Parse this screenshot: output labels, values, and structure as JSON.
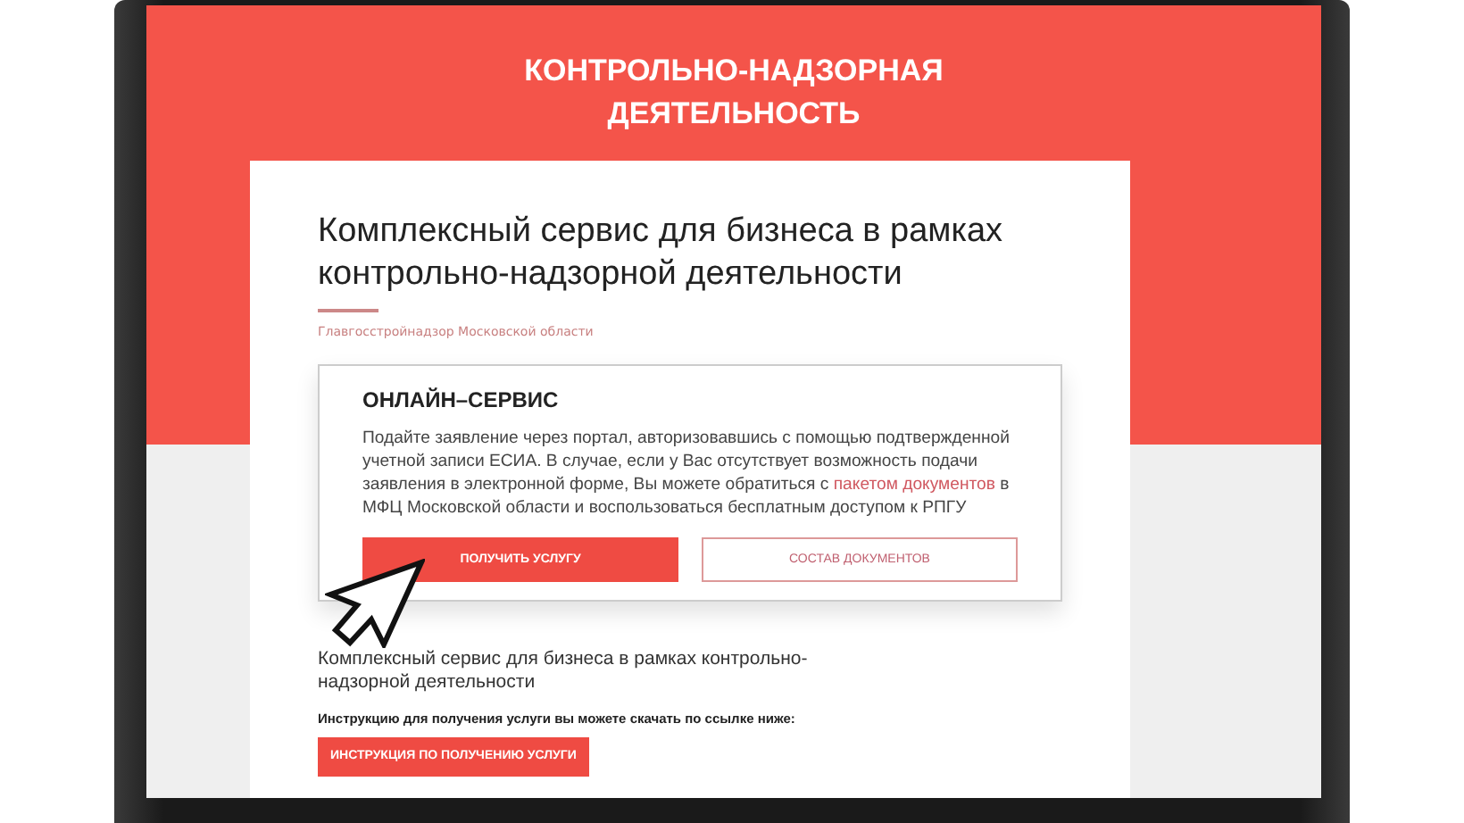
{
  "header": {
    "title": "КОНТРОЛЬНО-НАДЗОРНАЯ ДЕЯТЕЛЬНОСТЬ"
  },
  "card": {
    "heading": "Комплексный сервис для бизнеса в рамках контрольно-надзорной деятельности",
    "subtitle": "Главгосстройнадзор Московской области",
    "online_service": {
      "title": "ОНЛАЙН–СЕРВИС",
      "text_before": "Подайте заявление через портал, авторизовавшись с помощью подтвержденной учетной записи ЕСИА. В случае, если у Вас отсутствует возможность подачи заявления в электронной форме, Вы можете обратиться с ",
      "link": "пакетом документов",
      "text_after": " в МФЦ Московской области и воспользоваться бесплатным доступом к РПГУ",
      "buttons": [
        {
          "label": "ПОЛУЧИТЬ УСЛУГУ",
          "kind": "primary"
        },
        {
          "label": "СОСТАВ ДОКУМЕНТОВ",
          "kind": "outline"
        }
      ]
    },
    "description": "Комплексный сервис для бизнеса в рамках контрольно-надзорной деятельности",
    "instruction_note": "Инструкцию для получения услуги вы можете скачать по ссылке ниже:",
    "instruction_button": {
      "label": "ИНСТРУКЦИЯ ПО ПОЛУЧЕНИЮ УСЛУГИ",
      "kind": "primary"
    }
  }
}
